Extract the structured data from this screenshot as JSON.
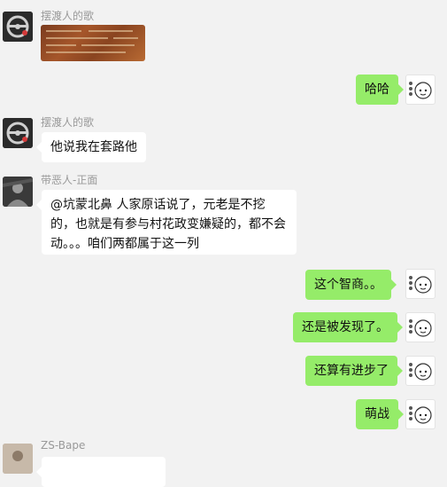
{
  "messages": [
    {
      "sender": "摆渡人的歌",
      "type": "image",
      "avatar": "steering-wheel-avatar"
    },
    {
      "type": "text",
      "direction": "out",
      "text": "哈哈"
    },
    {
      "sender": "摆渡人的歌",
      "type": "text",
      "direction": "in",
      "text": "他说我在套路他"
    },
    {
      "sender": "带恶人-正面",
      "type": "text",
      "direction": "in",
      "text": "@坑蒙北鼻 人家原话说了，元老是不挖的，也就是有参与村花政变嫌疑的，都不会动。。。咱们两都属于这一列"
    },
    {
      "type": "text",
      "direction": "out",
      "text": "这个智商。。"
    },
    {
      "type": "text",
      "direction": "out",
      "text": "还是被发现了。"
    },
    {
      "type": "text",
      "direction": "out",
      "text": "还算有进步了"
    },
    {
      "type": "text",
      "direction": "out",
      "text": "萌战"
    },
    {
      "sender": "ZS-Bape",
      "type": "text",
      "direction": "in",
      "text": ""
    }
  ],
  "colors": {
    "out_bubble": "#95ec69",
    "in_bubble": "#ffffff",
    "background": "#f2f2f2",
    "sender_name": "#999999"
  }
}
